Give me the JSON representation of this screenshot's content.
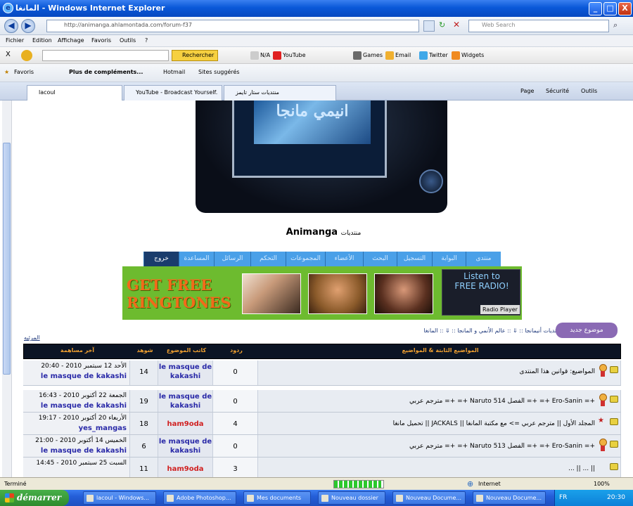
{
  "window": {
    "title": "المانغا - Windows Internet Explorer",
    "minimize": "_",
    "maximize": "□",
    "close": "X"
  },
  "address": {
    "url": "http://animanga.ahlamontada.com/forum-f37",
    "search_placeholder": "Web Search",
    "back": "◀",
    "forward": "▶"
  },
  "menu": [
    "Fichier",
    "Edition",
    "Affichage",
    "Favoris",
    "Outils",
    "?"
  ],
  "toolbar": {
    "close": "X",
    "search_btn": "Rechercher",
    "items": [
      "N/A",
      "YouTube",
      "Games",
      "Email",
      "Twitter",
      "Widgets"
    ]
  },
  "favorites": {
    "label": "Favoris",
    "items": [
      "Plus de compléments...",
      "Hotmail",
      "Sites suggérés"
    ]
  },
  "tabs": [
    {
      "label": "lacoul"
    },
    {
      "label": "YouTube - Broadcast Yourself."
    },
    {
      "label": "منتديات ستار تايمز"
    }
  ],
  "tabtools": [
    "Page",
    "Sécurité",
    "Outils"
  ],
  "page": {
    "device_text": "انيمي مانجا",
    "site_title_small": "منتديات",
    "site_title": "Animanga",
    "nav": [
      "منتدى",
      "البوابة",
      "التسجيل",
      "البحث",
      "الأعضاء",
      "المجموعات",
      "التحكم",
      "الرسائل",
      "المساعدة",
      "خروج"
    ],
    "banner": {
      "line1": "GET FREE",
      "line2": "RINGTONES",
      "radio1": "Listen to",
      "radio2": "FREE RADIO!",
      "radio_player": "Radio Player"
    },
    "breadcrumb": "منتديات أنيمانجا :: ⇓ :: عالم الأنمي و المانجا :: ⇓ :: المانغا",
    "new_topic": "موضوع جديد",
    "mark_read": "المرئيه",
    "headers": {
      "topics": "المواضيع الثابتة & المواضيع",
      "replies": "ردود",
      "author": "كاتب الموضوع",
      "views": "شوهد",
      "last": "آخر مساهمة"
    },
    "rows": [
      {
        "title": "المواضيع: قوانين هذا المنتدى",
        "replies": "0",
        "author": "le masque de kakashi",
        "views": "14",
        "last_date": "الأحد 12 سبتمبر 2010 - 20:40",
        "last_user": "le masque de kakashi"
      },
      {
        "title": "مترجم عربي =+ =+ Naruto 514 الفصل =+ =+ Ero-Sanin =+",
        "replies": "0",
        "author": "le masque de kakashi",
        "views": "19",
        "last_date": "الجمعة 22 أكتوبر 2010 - 16:43",
        "last_user": "le masque de kakashi"
      },
      {
        "title": "تحميل مانغا || JACKALS || المجلد الأول || مترجم عربي => مع مكتبة المانغا",
        "replies": "4",
        "author": "ham9oda",
        "views": "18",
        "last_date": "الأربعاء 20 أكتوبر 2010 - 19:17",
        "last_user": "yes_mangas"
      },
      {
        "title": "مترجم عربي =+ =+ Naruto 513 الفصل =+ =+ Ero-Sanin =+",
        "replies": "0",
        "author": "le masque de kakashi",
        "views": "6",
        "last_date": "الخميس 14 أكتوبر 2010 - 21:00",
        "last_user": "le masque de kakashi"
      },
      {
        "title": "... || ... ||",
        "replies": "3",
        "author": "ham9oda",
        "views": "11",
        "last_date": "السبت 25 سبتمبر 2010 - 14:45",
        "last_user": ""
      }
    ]
  },
  "status": {
    "left": "Terminé",
    "zone": "Internet",
    "zoom": "100%",
    "progress": 0.95
  },
  "taskbar": {
    "start": "démarrer",
    "items": [
      "lacoul - Windows...",
      "Adobe Photoshop...",
      "Mes documents",
      "Nouveau dossier",
      "Nouveau Docume...",
      "Nouveau Docume..."
    ],
    "clock": "20:30",
    "lang": "FR"
  }
}
